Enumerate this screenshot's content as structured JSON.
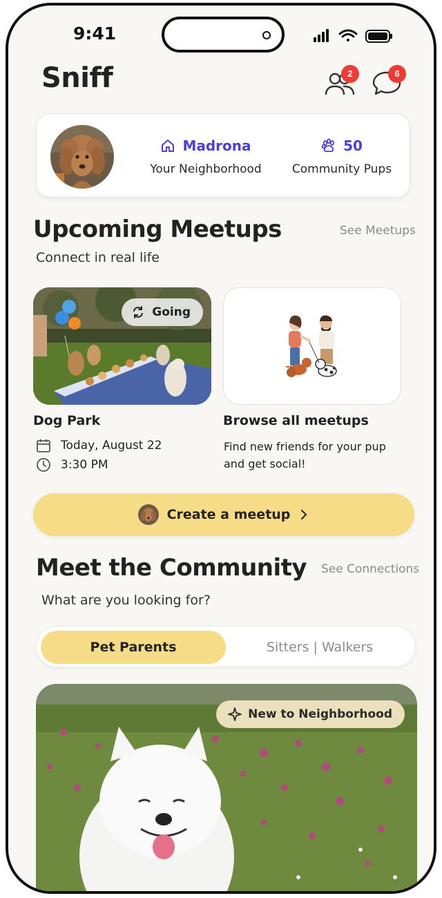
{
  "status_bar": {
    "time": "9:41"
  },
  "header": {
    "app_title": "Sniff",
    "friends_badge": "2",
    "messages_badge": "6"
  },
  "profile": {
    "neighborhood_value": "Madrona",
    "neighborhood_label": "Your Neighborhood",
    "pups_value": "50",
    "pups_label": "Community Pups"
  },
  "meetups": {
    "title": "Upcoming Meetups",
    "see_link": "See Meetups",
    "subtitle": "Connect in real life",
    "cards": [
      {
        "status": "Going",
        "name": "Dog Park",
        "date": "Today, August 22",
        "time": "3:30 PM"
      },
      {
        "name": "Browse all meetups",
        "description": "Find new friends for your pup and get social!"
      }
    ],
    "create_label": "Create a meetup"
  },
  "community": {
    "title": "Meet the Community",
    "see_link": "See Connections",
    "subtitle": "What are you looking for?",
    "tabs": [
      {
        "label": "Pet Parents",
        "active": true
      },
      {
        "label": "Sitters | Walkers",
        "active": false
      }
    ],
    "featured_badge": "New to Neighborhood"
  },
  "colors": {
    "accent": "#4a3ee0",
    "button_yellow": "#f6dc86",
    "badge_red": "#ee3b34"
  }
}
